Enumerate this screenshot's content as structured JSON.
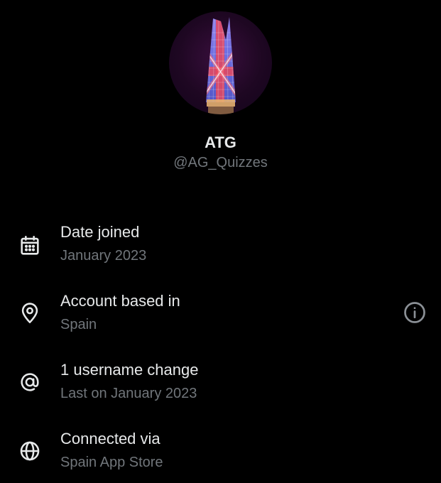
{
  "profile": {
    "display_name": "ATG",
    "handle": "@AG_Quizzes"
  },
  "rows": [
    {
      "icon": "calendar-icon",
      "title": "Date joined",
      "subtitle": "January 2023"
    },
    {
      "icon": "location-pin-icon",
      "title": "Account based in",
      "subtitle": "Spain",
      "action_icon": "info-icon"
    },
    {
      "icon": "at-sign-icon",
      "title": "1 username change",
      "subtitle": "Last on January 2023"
    },
    {
      "icon": "globe-icon",
      "title": "Connected via",
      "subtitle": "Spain App Store"
    }
  ],
  "colors": {
    "background": "#000000",
    "primary_text": "#e7e9ea",
    "secondary_text": "#71767b"
  }
}
